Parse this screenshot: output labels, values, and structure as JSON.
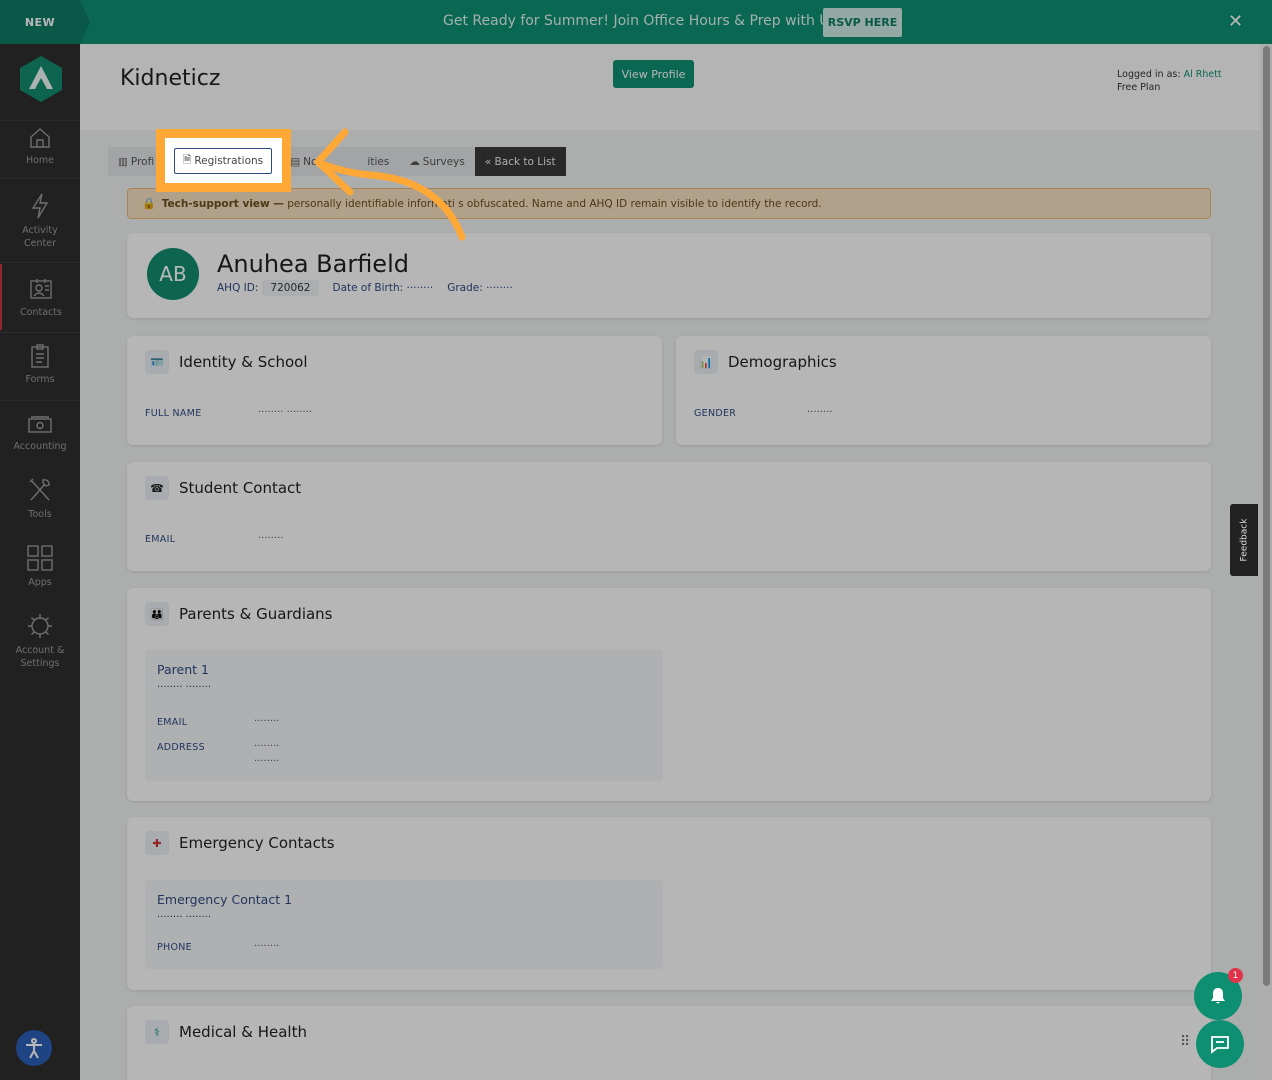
{
  "banner": {
    "tag": "NEW",
    "text": "Get Ready for Summer! Join Office Hours & Prep with Us",
    "rsvp": "RSVP HERE",
    "close": "✕"
  },
  "sidebar": {
    "items": [
      {
        "label": "Home",
        "icon": "home-icon"
      },
      {
        "label": "Activity Center",
        "icon": "lightning-icon"
      },
      {
        "label": "Contacts",
        "icon": "contacts-icon"
      },
      {
        "label": "Forms",
        "icon": "clipboard-icon"
      },
      {
        "label": "Accounting",
        "icon": "money-icon"
      },
      {
        "label": "Tools",
        "icon": "tools-icon"
      },
      {
        "label": "Apps",
        "icon": "apps-grid-icon"
      },
      {
        "label": "Account & Settings",
        "icon": "gear-icon"
      }
    ]
  },
  "header": {
    "org": "Kidneticz",
    "view_profile": "View Profile",
    "logged_in_prefix": "Logged in as:",
    "user": "Al Rhett",
    "plan": "Free Plan"
  },
  "tabs": [
    {
      "label": "Profi",
      "icon": "profile-icon"
    },
    {
      "label": "Registrations",
      "icon": "document-icon"
    },
    {
      "label": "No",
      "icon": "notes-icon"
    },
    {
      "label": "ities",
      "icon": "activities-icon"
    },
    {
      "label": "Surveys",
      "icon": "cloud-icon"
    },
    {
      "label": "« Back to List",
      "icon": ""
    }
  ],
  "notice": {
    "bold": "Tech-support view —",
    "text": " personally identifiable informati   s obfuscated. Name and AHQ ID remain visible to identify the record."
  },
  "profile": {
    "initials": "AB",
    "name": "Anuhea Barfield",
    "ahq_label": "AHQ ID:",
    "ahq_id": "720062",
    "dob_label": "Date of Birth:",
    "dob": "········",
    "grade_label": "Grade:",
    "grade": "········"
  },
  "identity": {
    "title": "Identity & School",
    "field": "FULL NAME",
    "value": "········ ········"
  },
  "demographics": {
    "title": "Demographics",
    "field": "GENDER",
    "value": "········"
  },
  "student_contact": {
    "title": "Student Contact",
    "field": "EMAIL",
    "value": "········"
  },
  "parents": {
    "title": "Parents & Guardians",
    "sub_title": "Parent 1",
    "name": "········ ········",
    "email_label": "EMAIL",
    "email": "········",
    "address_label": "ADDRESS",
    "address1": "········",
    "address2": "········"
  },
  "emergency": {
    "title": "Emergency Contacts",
    "sub_title": "Emergency Contact 1",
    "name": "········ ········",
    "phone_label": "PHONE",
    "phone": "········"
  },
  "medical": {
    "title": "Medical & Health"
  },
  "highlight": {
    "label": "Registrations"
  },
  "feedback": "Feedback",
  "notifications": {
    "count": "1"
  },
  "colors": {
    "brand": "#0f8f72",
    "highlight": "#ffa836",
    "sidebar": "#2e2e2e"
  }
}
